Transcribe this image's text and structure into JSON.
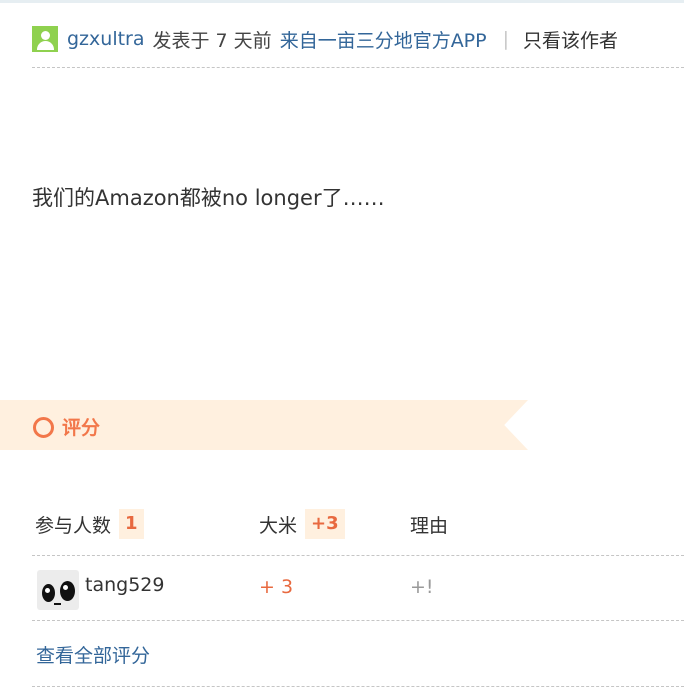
{
  "post": {
    "author": "gzxultra",
    "posted": "发表于 7 天前",
    "source": "来自一亩三分地官方APP",
    "separator": "|",
    "only_author": "只看该作者",
    "body": "我们的Amazon都被no longer了……"
  },
  "rating": {
    "title": "评分",
    "columns": {
      "participants_label": "参与人数",
      "participants_count": "1",
      "rice_label": "大米",
      "rice_total": "+3",
      "reason_label": "理由"
    },
    "rows": [
      {
        "user": "tang529",
        "score": "+ 3",
        "reason": "+!"
      }
    ],
    "view_all": "查看全部评分"
  },
  "colors": {
    "link": "#336699",
    "accent": "#f2774a",
    "banner_bg": "#fff0df",
    "avatar_green": "#8fd14f"
  }
}
